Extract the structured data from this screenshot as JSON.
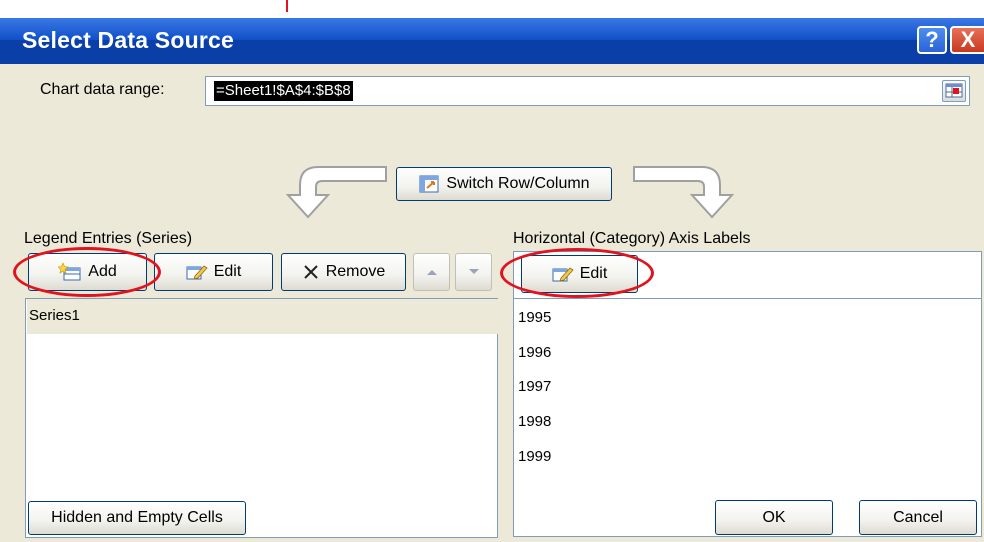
{
  "dialog": {
    "title": "Select Data Source",
    "help_label": "?",
    "close_label": "X"
  },
  "range": {
    "label": "Chart data range:",
    "value": "=Sheet1!$A$4:$B$8"
  },
  "switch_button": {
    "label": "Switch Row/Column"
  },
  "legend": {
    "heading": "Legend Entries (Series)",
    "add_label": "Add",
    "edit_label": "Edit",
    "remove_label": "Remove",
    "series": [
      "Series1"
    ]
  },
  "axis": {
    "heading": "Horizontal (Category) Axis Labels",
    "edit_label": "Edit",
    "labels": [
      "1995",
      "1996",
      "1997",
      "1998",
      "1999"
    ]
  },
  "footer": {
    "hidden_empty_label": "Hidden and Empty Cells",
    "ok_label": "OK",
    "cancel_label": "Cancel"
  },
  "colors": {
    "title_bar": "#0a3fa8",
    "dialog_face": "#ece9d8",
    "annotation_red": "#e0141e",
    "selected_row": "#ece9d8"
  },
  "icons": [
    "help-icon",
    "close-icon",
    "range-picker-icon",
    "switch-row-column-icon",
    "add-series-icon",
    "edit-icon",
    "remove-x-icon",
    "move-up-icon",
    "move-down-icon",
    "curved-arrow-left-icon",
    "curved-arrow-right-icon"
  ]
}
